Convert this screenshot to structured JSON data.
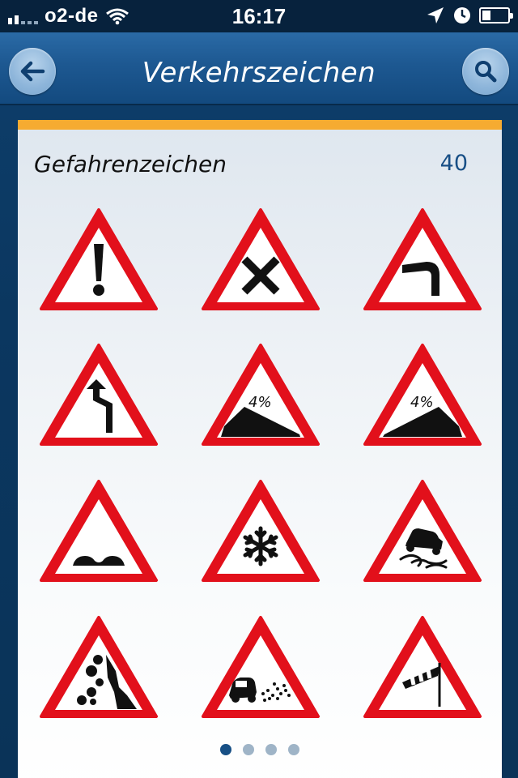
{
  "status_bar": {
    "carrier": "o2-de",
    "time": "16:17"
  },
  "nav": {
    "title": "Verkehrszeichen",
    "back_icon": "arrow-left-icon",
    "search_icon": "magnifier-icon"
  },
  "category": {
    "title": "Gefahrenzeichen",
    "count": "40"
  },
  "signs": [
    {
      "name": "sign-general-danger"
    },
    {
      "name": "sign-crossroads"
    },
    {
      "name": "sign-curve-right"
    },
    {
      "name": "sign-double-curve"
    },
    {
      "name": "sign-steep-descent",
      "label": "4%"
    },
    {
      "name": "sign-steep-ascent",
      "label": "4%"
    },
    {
      "name": "sign-uneven-road"
    },
    {
      "name": "sign-snow-ice"
    },
    {
      "name": "sign-slippery-road"
    },
    {
      "name": "sign-falling-rocks"
    },
    {
      "name": "sign-loose-gravel"
    },
    {
      "name": "sign-crosswind"
    }
  ],
  "pagination": {
    "pages": 4,
    "current": 1
  },
  "colors": {
    "accent": "#f6ab31",
    "count": "#184f86",
    "sign_red": "#e2101b",
    "dot_active": "#174f85",
    "dot_inactive": "#9fb4c7"
  }
}
